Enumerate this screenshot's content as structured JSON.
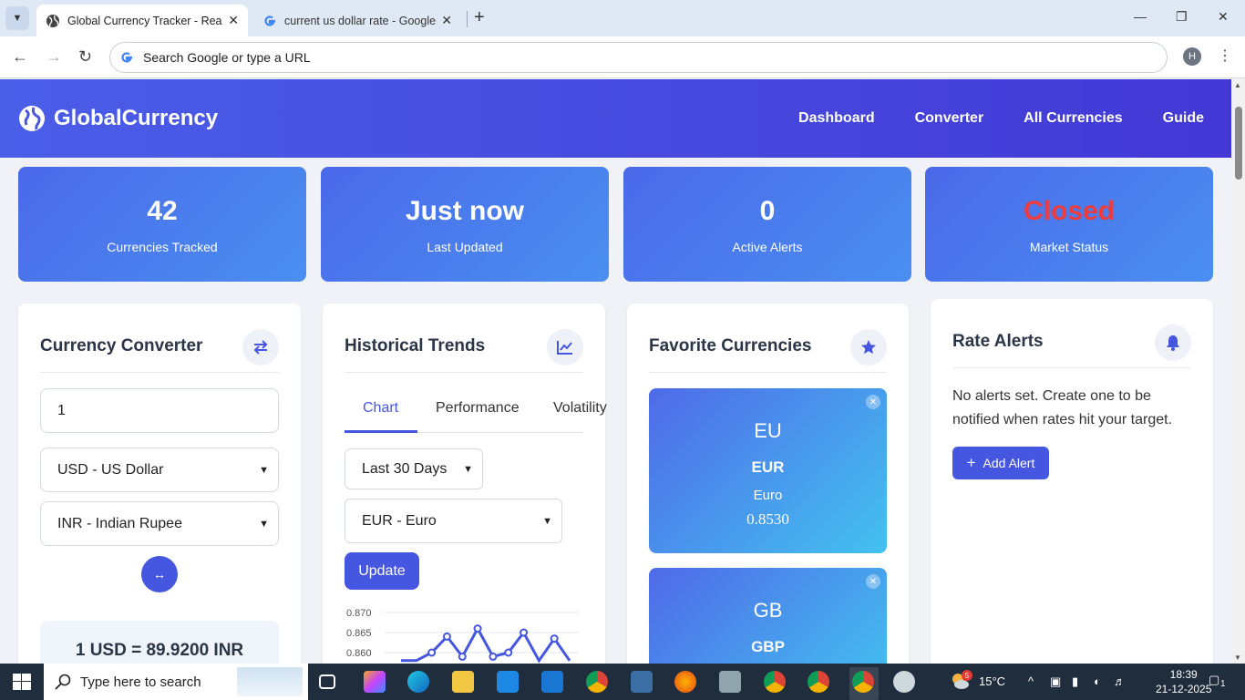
{
  "browser": {
    "tabs": [
      {
        "title": "Global Currency Tracker - Real-T",
        "active": true
      },
      {
        "title": "current us dollar rate - Google S",
        "active": false
      }
    ],
    "omnibox_placeholder": "Search Google or type a URL",
    "profile_initial": "H"
  },
  "header": {
    "brand": "GlobalCurrency",
    "nav": [
      "Dashboard",
      "Converter",
      "All Currencies",
      "Guide"
    ]
  },
  "stats": [
    {
      "value": "42",
      "label": "Currencies Tracked"
    },
    {
      "value": "Just now",
      "label": "Last Updated"
    },
    {
      "value": "0",
      "label": "Active Alerts"
    },
    {
      "value": "Closed",
      "label": "Market Status"
    }
  ],
  "converter": {
    "title": "Currency Converter",
    "amount": "1",
    "from": "USD - US Dollar",
    "to": "INR - Indian Rupee",
    "result": "1 USD = 89.9200 INR"
  },
  "trends": {
    "title": "Historical Trends",
    "tabs": [
      "Chart",
      "Performance",
      "Volatility"
    ],
    "period": "Last 30 Days",
    "currency": "EUR - Euro",
    "update_label": "Update",
    "y_ticks": [
      "0.870",
      "0.865",
      "0.860"
    ]
  },
  "chart_data": {
    "type": "line",
    "title": "",
    "xlabel": "",
    "ylabel": "",
    "ylim": [
      0.858,
      0.87
    ],
    "series": [
      {
        "name": "EUR",
        "values": [
          0.858,
          0.858,
          0.86,
          0.864,
          0.859,
          0.866,
          0.859,
          0.86,
          0.865,
          0.858,
          0.8635,
          0.858
        ]
      }
    ]
  },
  "favorites": {
    "title": "Favorite Currencies",
    "items": [
      {
        "flag": "EU",
        "code": "EUR",
        "name": "Euro",
        "rate": "0.8530"
      },
      {
        "flag": "GB",
        "code": "GBP",
        "name": "",
        "rate": ""
      }
    ]
  },
  "alerts": {
    "title": "Rate Alerts",
    "empty_text": "No alerts set. Create one to be notified when rates hit your target.",
    "add_label": "Add Alert"
  },
  "taskbar": {
    "search_placeholder": "Type here to search",
    "weather": "15°C",
    "weather_badge": "5",
    "time": "18:39",
    "date": "21-12-2025",
    "notifications": "1"
  },
  "colors": {
    "primary": "#4556e0",
    "closed": "#ef3b3b"
  }
}
